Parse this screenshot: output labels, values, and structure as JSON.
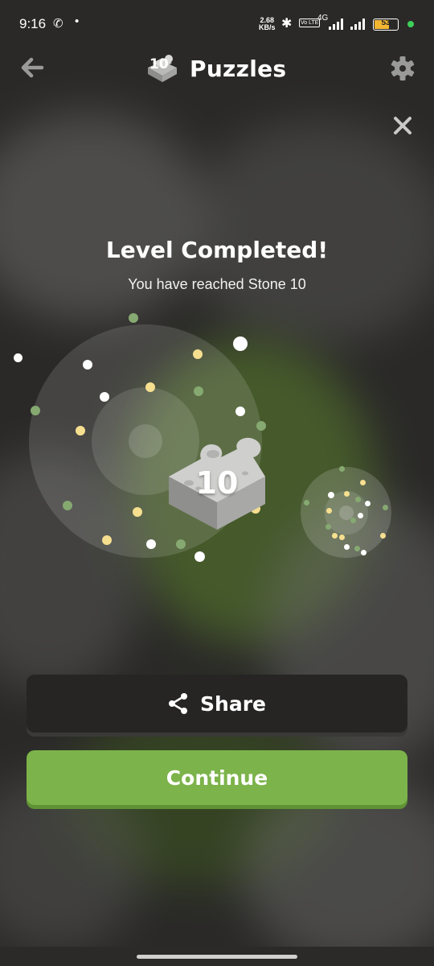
{
  "status_bar": {
    "time": "9:16",
    "net_speed_value": "2.68",
    "net_speed_unit": "KB/s",
    "volte": "Vo LTE",
    "network": "4G",
    "battery": "53"
  },
  "header": {
    "title": "Puzzles",
    "badge_number": "10"
  },
  "dialog": {
    "heading": "Level Completed!",
    "subheading": "You have reached Stone 10",
    "puzzle_number": "10"
  },
  "buttons": {
    "share_label": "Share",
    "continue_label": "Continue"
  },
  "colors": {
    "accent_green": "#7cb34a",
    "background": "#2a2928",
    "particle_white": "#ffffff",
    "particle_yellow": "#f6df8f",
    "particle_green": "#86a971"
  },
  "icons": {
    "back": "arrow-left-icon",
    "settings": "gear-icon",
    "close": "close-icon",
    "share": "share-icon",
    "puzzle": "puzzle-piece-icon",
    "call": "phone-call-icon",
    "bluetooth": "bluetooth-icon"
  }
}
